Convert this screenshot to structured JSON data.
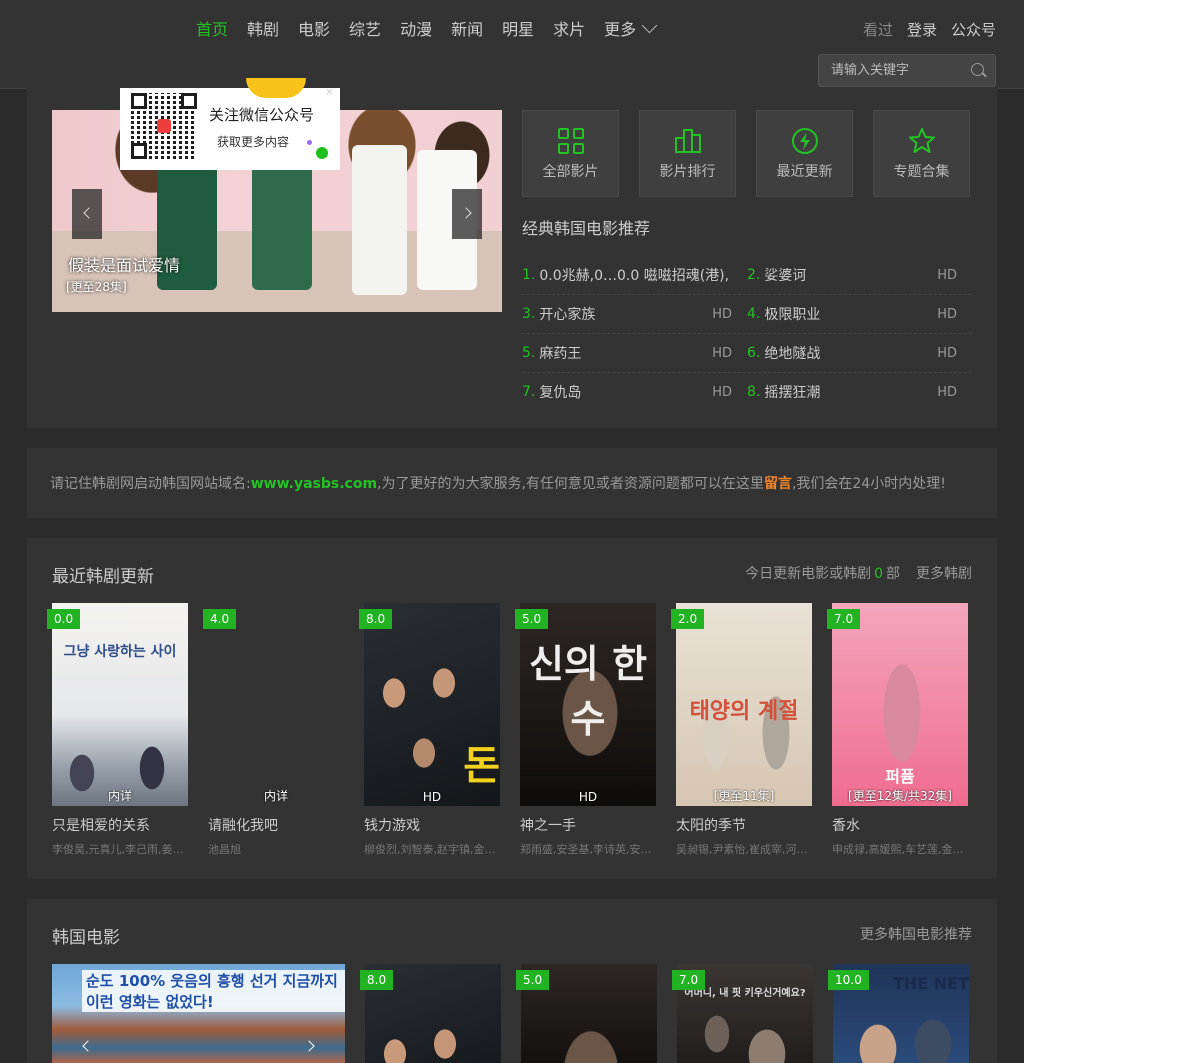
{
  "nav": {
    "items": [
      "首页",
      "韩剧",
      "电影",
      "综艺",
      "动漫",
      "新闻",
      "明星",
      "求片",
      "更多"
    ],
    "active": "首页"
  },
  "header_links": {
    "history": "看过",
    "login": "登录",
    "wechat": "公众号"
  },
  "search": {
    "placeholder": "请输入关键字"
  },
  "qr_popup": {
    "title": "关注微信公众号",
    "subtitle": "获取更多内容"
  },
  "slider": {
    "title": "假装是面试爱情",
    "subtitle": "[更至28集]"
  },
  "categories": [
    "全部影片",
    "影片排行",
    "最近更新",
    "专题合集"
  ],
  "recommend": {
    "title": "经典韩国电影推荐",
    "items": [
      {
        "n": "1.",
        "name": "0.0兆赫,0…0.0 嗞嗞招魂(港),",
        "q": ""
      },
      {
        "n": "2.",
        "name": "娑婆诃",
        "q": "HD"
      },
      {
        "n": "3.",
        "name": "开心家族",
        "q": "HD"
      },
      {
        "n": "4.",
        "name": "极限职业",
        "q": "HD"
      },
      {
        "n": "5.",
        "name": "麻药王",
        "q": "HD"
      },
      {
        "n": "6.",
        "name": "绝地隧战",
        "q": "HD"
      },
      {
        "n": "7.",
        "name": "复仇岛",
        "q": "HD"
      },
      {
        "n": "8.",
        "name": "摇摆狂潮",
        "q": "HD"
      }
    ]
  },
  "notice": {
    "pre": "请记住韩剧网启动韩国网站域名:",
    "domain": "www.yasbs.com",
    "mid": ",为了更好的为大家服务,有任何意见或者资源问题都可以在这里",
    "link": "留言",
    "post": ",我们会在24小时内处理!"
  },
  "drama_section": {
    "title": "最近韩剧更新",
    "today_pre": "今日更新电影或韩剧",
    "today_count": "0",
    "today_unit": "部",
    "more": "更多韩剧",
    "cards": [
      {
        "score": "0.0",
        "status": "内详",
        "name": "只是相爱的关系",
        "cast": "李俊昊,元真儿,李己雨,姜…",
        "poster_text": "그냥 사랑하는 사이"
      },
      {
        "score": "4.0",
        "status": "内详",
        "name": "请融化我吧",
        "cast": "池昌旭",
        "poster_text": ""
      },
      {
        "score": "8.0",
        "status": "HD",
        "name": "钱力游戏",
        "cast": "柳俊烈,刘智泰,赵宇镇,金…",
        "poster_text": "돈"
      },
      {
        "score": "5.0",
        "status": "HD",
        "name": "神之一手",
        "cast": "郑雨盛,安圣基,李诗英,安…",
        "poster_text": "신의 한 수"
      },
      {
        "score": "2.0",
        "status": "[更至11集]",
        "name": "太阳的季节",
        "cast": "吴昶锡,尹素怡,崔成宰,河…",
        "poster_text": "태양의 계절"
      },
      {
        "score": "7.0",
        "status": "[更至12集/共32集]",
        "name": "香水",
        "cast": "申成禄,高媛熙,车艺莲,金…",
        "poster_text": "퍼퓸"
      }
    ]
  },
  "movie_section": {
    "title": "韩国电影",
    "more": "更多韩国电影推荐",
    "banner_text": "순도 100% 웃음의 흥행 선거 지금까지 이런 영화는 없었다!",
    "cards": [
      {
        "score": "8.0",
        "poster_text": ""
      },
      {
        "score": "5.0",
        "poster_text": ""
      },
      {
        "score": "7.0",
        "poster_text": "어머니, 내 핏 키우신거예요?"
      },
      {
        "score": "10.0",
        "poster_text": "THE NET"
      }
    ]
  },
  "colors": {
    "accent": "#22c322",
    "highlight": "#f2852a",
    "panel": "#333333",
    "background": "#2b2b2b"
  }
}
